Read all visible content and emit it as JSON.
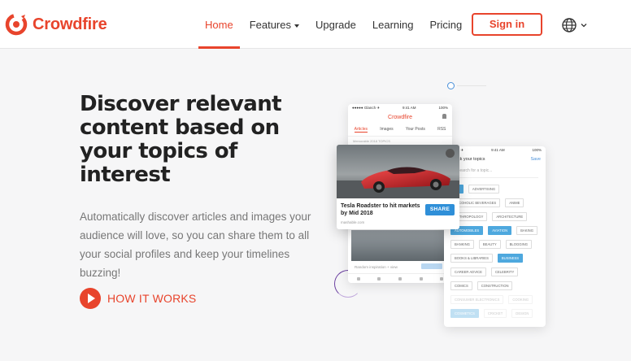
{
  "header": {
    "brand": "Crowdfire",
    "nav": [
      {
        "label": "Home",
        "active": true,
        "dropdown": false
      },
      {
        "label": "Features",
        "active": false,
        "dropdown": true
      },
      {
        "label": "Upgrade",
        "active": false,
        "dropdown": false
      },
      {
        "label": "Learning",
        "active": false,
        "dropdown": false
      },
      {
        "label": "Pricing",
        "active": false,
        "dropdown": false
      }
    ],
    "signin_label": "Sign in",
    "language_icon": "globe-icon"
  },
  "hero": {
    "title": "Discover relevant content based on your topics of interest",
    "description": "Automatically discover articles and images your audience will love, so you can share them to all your social profiles and keep your timelines buzzing!",
    "cta_label": "HOW IT WORKS"
  },
  "illustration": {
    "back_phone": {
      "status_left": "●●●●● Glanch ✈",
      "status_time": "9:41 AM",
      "status_right": "100%",
      "brand": "Crowdfire",
      "tabs": [
        "Articles",
        "Images",
        "Your Posts",
        "RSS"
      ],
      "subheading": "Memorable 2018 TOPICS",
      "caption": "Random inspiration + view"
    },
    "card": {
      "title": "Tesla Roadster to hit markets by Mid 2018",
      "source": "mashable.com",
      "share_label": "SHARE"
    },
    "right_phone": {
      "status_left": "Glanch ✈",
      "status_time": "9:41 AM",
      "status_right": "100%",
      "title": "Pick your topics",
      "save_label": "Save",
      "search_placeholder": "Search for a topic...",
      "topics": [
        {
          "label": "ad",
          "selected": true,
          "faint": false
        },
        {
          "label": "Advertising",
          "selected": false,
          "faint": false
        },
        {
          "label": "alcoholic beverages",
          "selected": false,
          "faint": false
        },
        {
          "label": "anime",
          "selected": false,
          "faint": false
        },
        {
          "label": "anthropology",
          "selected": false,
          "faint": false
        },
        {
          "label": "architecture",
          "selected": false,
          "faint": false
        },
        {
          "label": "automobiles",
          "selected": true,
          "faint": false
        },
        {
          "label": "aviation",
          "selected": true,
          "faint": false
        },
        {
          "label": "baking",
          "selected": false,
          "faint": false
        },
        {
          "label": "banking",
          "selected": false,
          "faint": false
        },
        {
          "label": "beauty",
          "selected": false,
          "faint": false
        },
        {
          "label": "blogging",
          "selected": false,
          "faint": false
        },
        {
          "label": "books & libraries",
          "selected": false,
          "faint": false
        },
        {
          "label": "business",
          "selected": true,
          "faint": false
        },
        {
          "label": "career advice",
          "selected": false,
          "faint": false
        },
        {
          "label": "celebrity",
          "selected": false,
          "faint": false
        },
        {
          "label": "comics",
          "selected": false,
          "faint": false
        },
        {
          "label": "construction",
          "selected": false,
          "faint": false
        },
        {
          "label": "consumer electronics",
          "selected": false,
          "faint": true
        },
        {
          "label": "cooking",
          "selected": false,
          "faint": true
        },
        {
          "label": "cosmetics",
          "selected": true,
          "faint": true
        },
        {
          "label": "cricket",
          "selected": false,
          "faint": true
        },
        {
          "label": "design",
          "selected": false,
          "faint": true
        }
      ]
    }
  },
  "colors": {
    "brand": "#e8442c",
    "share": "#2f8fd8",
    "chip_selected": "#4ea8de",
    "background": "#f6f6f7"
  }
}
